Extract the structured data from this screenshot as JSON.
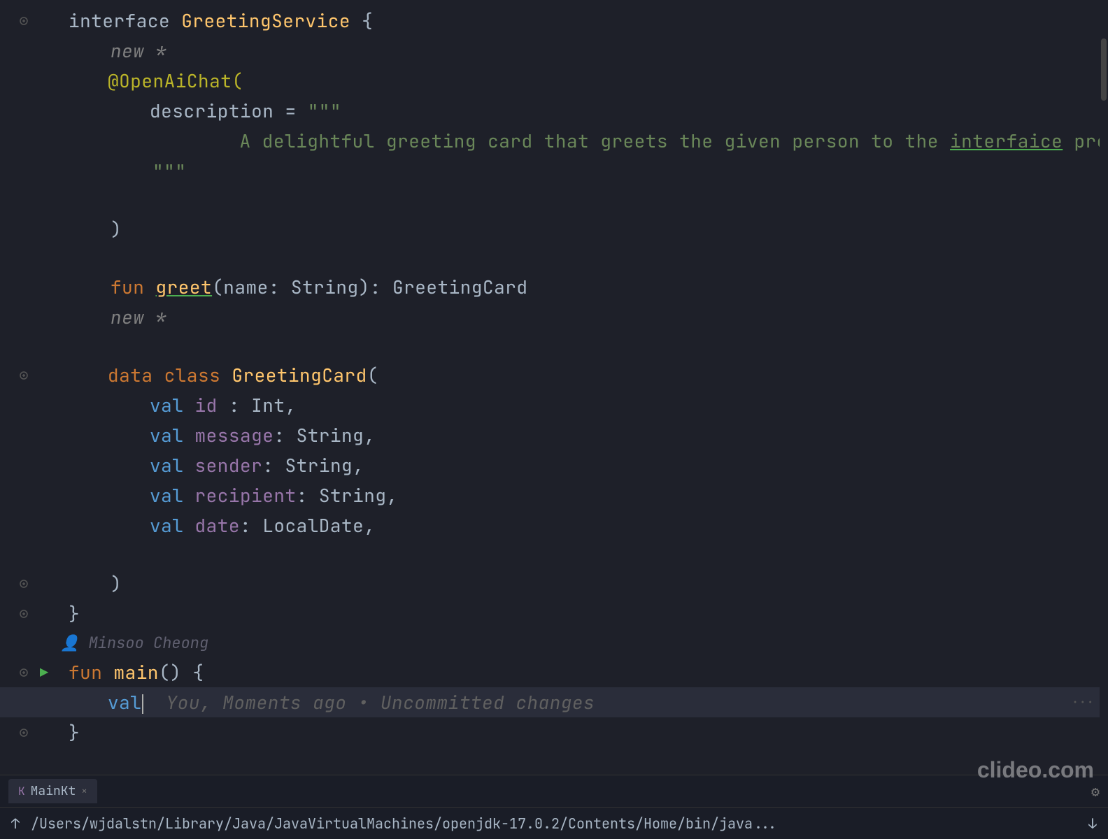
{
  "editor": {
    "background": "#1e2029",
    "lines": [
      {
        "id": 1,
        "indent": 0,
        "hasFoldIcon": true,
        "foldIcon": "▼",
        "hasBlueBar": false,
        "blueBarHeight": 0,
        "blueBarTop": 0,
        "content_html": "<span class='plain'>interface </span><span class='cls'>GreetingService</span><span class='plain'> {</span>",
        "isActive": false
      },
      {
        "id": 2,
        "indent": 1,
        "hasBlueBar": false,
        "content_html": "<span class='new-marker'>new *</span>",
        "isActive": false
      },
      {
        "id": 3,
        "indent": 1,
        "hasBlueBar": true,
        "blueBarHeight": 40,
        "blueBarTop": 0,
        "content_html": "<span class='annotation'>@OpenAiChat(</span>",
        "isActive": false
      },
      {
        "id": 4,
        "indent": 2,
        "hasBlueBar": true,
        "content_html": "<span class='plain'>description = </span><span class='str'>\"\"\"</span>",
        "isActive": false
      },
      {
        "id": 5,
        "indent": 3,
        "hasBlueBar": false,
        "content_html": "<span class='str'>    A delightful greeting card that greets the given person to the </span><span class='str underline-green'>interfaice</span><span class='str'> project.</span>",
        "isActive": false,
        "isLongLine": true
      },
      {
        "id": 6,
        "indent": 2,
        "hasBlueBar": false,
        "content_html": "<span class='str'>\"\"\"</span>",
        "isActive": false
      },
      {
        "id": 7,
        "indent": 0,
        "hasBlueBar": false,
        "content_html": "",
        "isActive": false
      },
      {
        "id": 8,
        "indent": 1,
        "hasBlueBar": false,
        "content_html": "<span class='plain'>)</span>",
        "isActive": false
      },
      {
        "id": 9,
        "indent": 0,
        "hasBlueBar": false,
        "content_html": "",
        "isActive": false
      },
      {
        "id": 10,
        "indent": 1,
        "hasBlueBar": false,
        "content_html": "<span class='kw'>fun </span><span class='fn underline-green'>greet</span><span class='plain'>(name: String): GreetingCard</span>",
        "isActive": false
      },
      {
        "id": 11,
        "indent": 1,
        "hasBlueBar": false,
        "content_html": "<span class='new-marker'>new *</span>",
        "isActive": false
      },
      {
        "id": 12,
        "indent": 0,
        "hasBlueBar": false,
        "content_html": "",
        "isActive": false
      },
      {
        "id": 13,
        "indent": 1,
        "hasFoldIcon": true,
        "foldIcon": "▼",
        "hasBlueBar": true,
        "content_html": "<span class='kw'>data class </span><span class='cls'>GreetingCard</span><span class='plain'>(</span>",
        "isActive": false
      },
      {
        "id": 14,
        "indent": 2,
        "hasBlueBar": true,
        "content_html": "<span class='kw-blue'>val </span><span class='param'>id</span><span class='plain'> : Int,</span>",
        "isActive": false
      },
      {
        "id": 15,
        "indent": 2,
        "hasBlueBar": true,
        "content_html": "<span class='kw-blue'>val </span><span class='param'>message</span><span class='plain'>: String,</span>",
        "isActive": false
      },
      {
        "id": 16,
        "indent": 2,
        "hasBlueBar": true,
        "content_html": "<span class='kw-blue'>val </span><span class='param'>sender</span><span class='plain'>: String,</span>",
        "isActive": false
      },
      {
        "id": 17,
        "indent": 2,
        "hasBlueBar": true,
        "content_html": "<span class='kw-blue'>val </span><span class='param'>recipient</span><span class='plain'>: String,</span>",
        "isActive": false
      },
      {
        "id": 18,
        "indent": 2,
        "hasBlueBar": true,
        "content_html": "<span class='kw-blue'>val </span><span class='param'>date</span><span class='plain'>: LocalDate,</span>",
        "isActive": false
      },
      {
        "id": 19,
        "indent": 0,
        "hasBlueBar": false,
        "content_html": "",
        "isActive": false
      },
      {
        "id": 20,
        "indent": 1,
        "hasFoldIcon": true,
        "foldIcon": "▼",
        "hasBlueBar": false,
        "content_html": "<span class='plain'>)</span>",
        "isActive": false
      },
      {
        "id": 21,
        "indent": 0,
        "hasFoldIcon": true,
        "foldIcon": "▼",
        "hasBlueBar": false,
        "content_html": "<span class='plain'>}</span>",
        "isActive": false
      },
      {
        "id": 22,
        "indent": 0,
        "hasBlueBar": false,
        "hasUserInfo": true,
        "userInfo": "👤 Minsoo Cheong",
        "content_html": "",
        "isActive": false
      },
      {
        "id": 23,
        "indent": 0,
        "hasRunButton": true,
        "hasFoldIcon": true,
        "foldIcon": "▼",
        "hasBlueBar": false,
        "content_html": "<span class='kw'>fun </span><span class='fn'>main</span><span class='plain'>() {</span>",
        "isActive": false
      },
      {
        "id": 24,
        "indent": 1,
        "hasBlueBar": true,
        "isActive": true,
        "content_html": "<span class='kw-blue'>val</span><span class='cursor'></span><span class='git-hint'>  You, Moments ago • Uncommitted changes</span>",
        "hasDots": true
      },
      {
        "id": 25,
        "indent": 0,
        "hasFoldIcon": true,
        "foldIcon": "▼",
        "hasBlueBar": false,
        "content_html": "<span class='plain'>}</span>",
        "isActive": false
      }
    ]
  },
  "tab_bar": {
    "tabs": [
      {
        "label": "MainKt",
        "icon": "K",
        "closable": true
      }
    ],
    "gear_icon": "⚙"
  },
  "status_bar": {
    "path": "/Users/wjdalstn/Library/Java/JavaVirtualMachines/openjdk-17.0.2/Contents/Home/bin/java...",
    "up_arrow": "↑",
    "down_arrow": "↓"
  },
  "watermark": {
    "text": "clideo.com"
  }
}
